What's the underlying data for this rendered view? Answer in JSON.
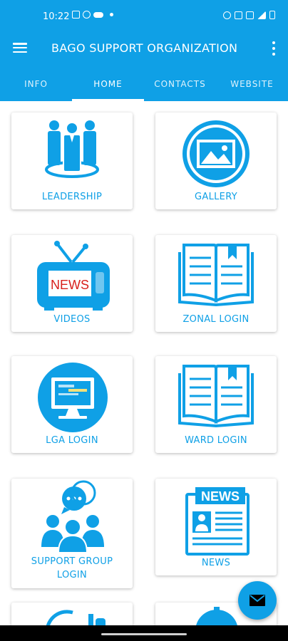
{
  "status_bar": {
    "time": "10:22",
    "left_icons": [
      "gallery-icon",
      "whatsapp-icon",
      "cloud-icon",
      "dot-icon"
    ],
    "right_icons": [
      "alarm-icon",
      "nfc-icon",
      "data-icon",
      "signal-icon",
      "battery-icon"
    ]
  },
  "app_bar": {
    "title": "BAGO SUPPORT ORGANIZATION",
    "menu_icon": "hamburger-menu-icon",
    "overflow_icon": "more-vertical-icon"
  },
  "tabs": [
    {
      "label": "INFO",
      "active": false
    },
    {
      "label": "HOME",
      "active": true
    },
    {
      "label": "CONTACTS",
      "active": false
    },
    {
      "label": "WEBSITE",
      "active": false
    }
  ],
  "cards": [
    {
      "label": "LEADERSHIP",
      "icon": "leadership-icon"
    },
    {
      "label": "GALLERY",
      "icon": "gallery-image-icon"
    },
    {
      "label": "VIDEOS",
      "icon": "tv-news-icon",
      "icon_text": "NEWS"
    },
    {
      "label": "ZONAL LOGIN",
      "icon": "open-book-icon"
    },
    {
      "label": "LGA LOGIN",
      "icon": "computer-monitor-icon"
    },
    {
      "label": "WARD LOGIN",
      "icon": "open-book-icon"
    },
    {
      "label": "SUPPORT GROUP LOGIN",
      "label_line1": "SUPPORT GROUP",
      "label_line2": "LOGIN",
      "icon": "support-group-icon"
    },
    {
      "label": "NEWS",
      "icon": "newspaper-icon",
      "icon_text": "NEWS"
    }
  ],
  "fab": {
    "icon": "email-icon"
  },
  "colors": {
    "primary": "#0fa0e6",
    "news_red": "#d8201c",
    "background": "#ffffff"
  }
}
